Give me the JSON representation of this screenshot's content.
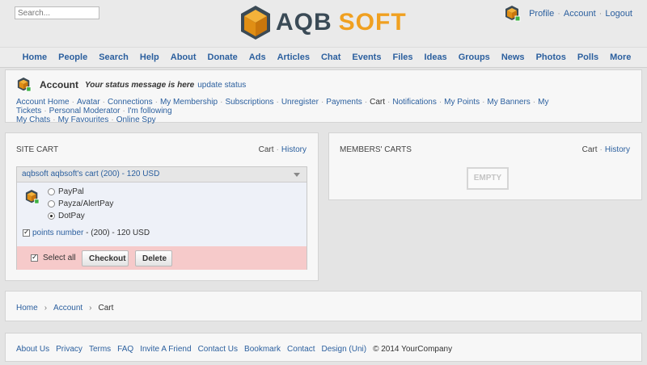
{
  "search": {
    "placeholder": "Search..."
  },
  "logo": {
    "part1": "AQB",
    "part2": "SOFT"
  },
  "user_menu": {
    "profile": "Profile",
    "account": "Account",
    "logout": "Logout",
    "sep": "·"
  },
  "nav": [
    "Home",
    "People",
    "Search",
    "Help",
    "About",
    "Donate",
    "Ads",
    "Articles",
    "Chat",
    "Events",
    "Files",
    "Ideas",
    "Groups",
    "News",
    "Photos",
    "Polls",
    "More"
  ],
  "account": {
    "title": "Account",
    "status": "Your status message is here",
    "update": "update status",
    "links": [
      "Account Home",
      "Avatar",
      "Connections",
      "My Membership",
      "Subscriptions",
      "Unregister",
      "Payments",
      "Cart",
      "Notifications",
      "My Points",
      "My Banners",
      "My Tickets",
      "Personal Moderator",
      "I'm following",
      "My Chats",
      "My Favourites",
      "Online Spy"
    ]
  },
  "site_cart": {
    "title": "Site Cart",
    "link_cart": "Cart",
    "link_history": "History",
    "cart_name": "aqbsoft aqbsoft's cart (200) - 120 USD",
    "payments": [
      {
        "label": "PayPal",
        "selected": false
      },
      {
        "label": "Payza/AlertPay",
        "selected": false
      },
      {
        "label": "DotPay",
        "selected": true
      }
    ],
    "item_link": "points number",
    "item_detail": " - (200) - 120 USD",
    "select_all": "Select all",
    "checkout": "Checkout",
    "delete": "Delete"
  },
  "members_carts": {
    "title": "Members' Carts",
    "link_cart": "Cart",
    "link_history": "History",
    "empty": "EMPTY"
  },
  "breadcrumb": {
    "home": "Home",
    "account": "Account",
    "current": "Cart",
    "sep": "›"
  },
  "footer": {
    "links": [
      "About Us",
      "Privacy",
      "Terms",
      "FAQ",
      "Invite A Friend",
      "Contact Us",
      "Bookmark",
      "Contact",
      "Design (Uni)"
    ],
    "copyright": "© 2014 YourCompany"
  }
}
